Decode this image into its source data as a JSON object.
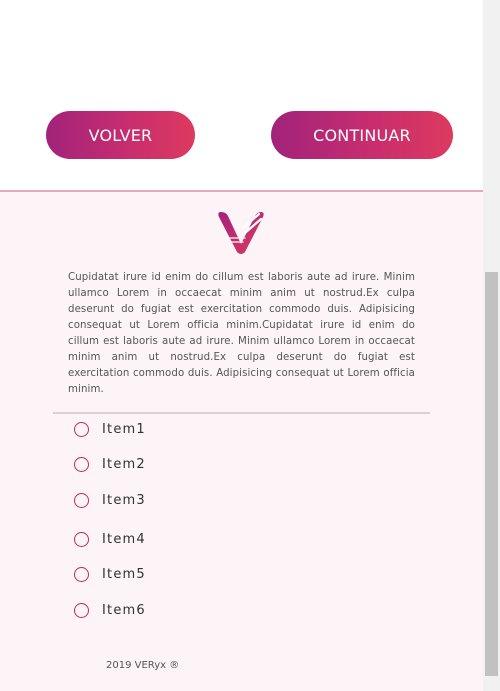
{
  "actions": {
    "back_label": "VOLVER",
    "continue_label": "CONTINUAR"
  },
  "colors": {
    "accent_start": "#a1237b",
    "accent_end": "#dc3a5e",
    "panel_bg": "#fcf4f6"
  },
  "logo": {
    "icon": "veryx-v-logo-icon"
  },
  "content": {
    "text": "Cupidatat irure id enim do cillum est laboris aute ad irure. Minim ullamco Lorem in occaecat minim anim ut nostrud.Ex culpa deserunt do fugiat est exercitation commodo duis. Adipisicing consequat ut Lorem officia minim.Cupidatat irure id enim do cillum est laboris aute ad irure. Minim ullamco Lorem in occaecat minim anim ut nostrud.Ex culpa deserunt do fugiat est exercitation commodo duis. Adipisicing consequat ut Lorem officia minim."
  },
  "options": [
    {
      "label": "Item1"
    },
    {
      "label": "Item2"
    },
    {
      "label": "Item3"
    },
    {
      "label": "Item4"
    },
    {
      "label": "Item5"
    },
    {
      "label": "Item6"
    }
  ],
  "footer": {
    "text": "2019 VERyx ®"
  }
}
